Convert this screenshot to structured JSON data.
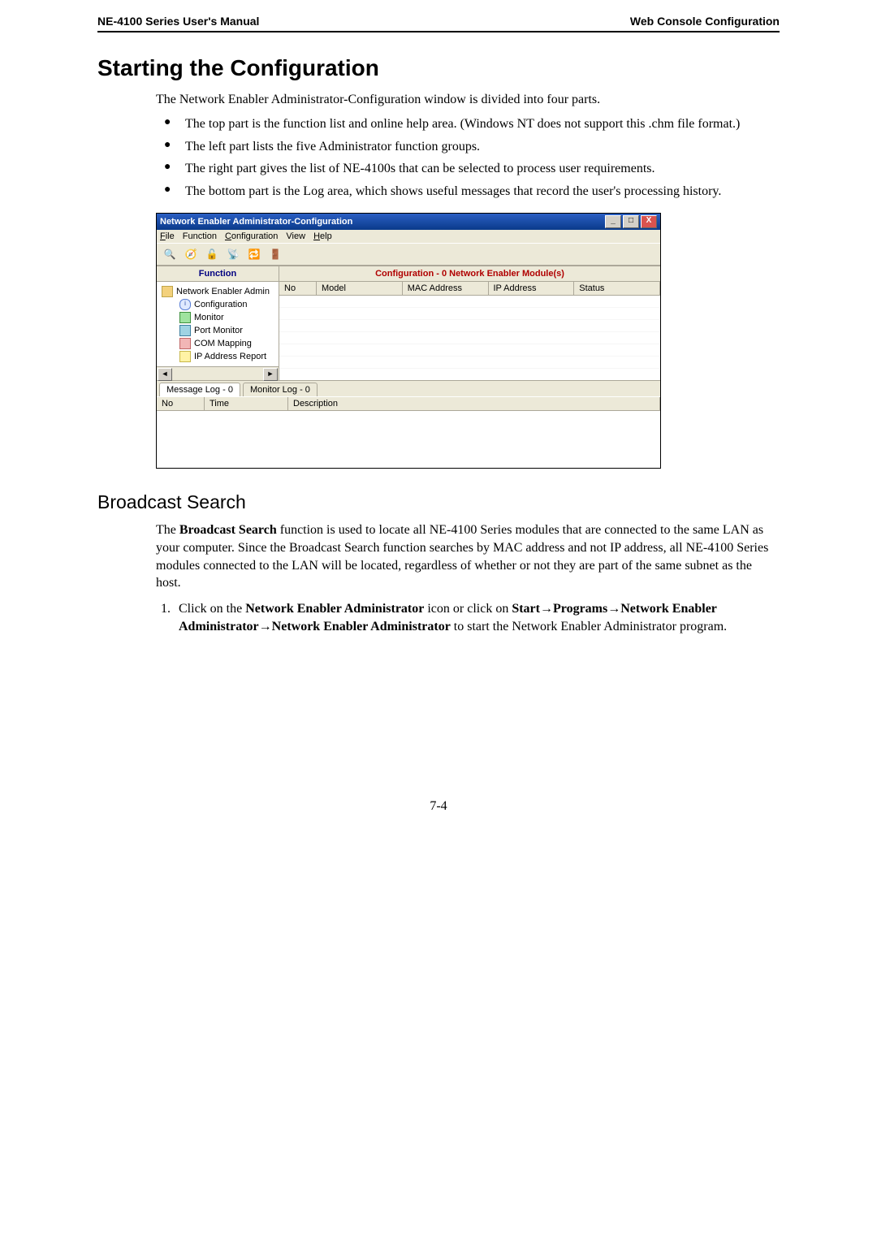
{
  "header": {
    "left": "NE-4100 Series User's Manual",
    "right": "Web Console Configuration"
  },
  "section_title": "Starting the Configuration",
  "intro": "The Network Enabler Administrator-Configuration window is divided into four parts.",
  "bullets": [
    "The top part is the function list and online help area. (Windows NT does not support this .chm file format.)",
    "The left part lists the five Administrator function groups.",
    "The right part gives the list of NE-4100s that can be selected to process user requirements.",
    "The bottom part is the Log area, which shows useful messages that record the user's processing history."
  ],
  "screenshot": {
    "title": "Network Enabler Administrator-Configuration",
    "win_buttons": {
      "min": "_",
      "max": "□",
      "close": "X"
    },
    "menu": [
      "File",
      "Function",
      "Configuration",
      "View",
      "Help"
    ],
    "menu_underlines": [
      "F",
      "",
      "C",
      "",
      "H"
    ],
    "toolbar_icons": [
      "search-icon",
      "locate-icon",
      "unlock-icon",
      "broadcast-icon",
      "refresh-icon",
      "exit-icon"
    ],
    "left_pane": {
      "header": "Function",
      "root": "Network Enabler Admin",
      "items": [
        "Configuration",
        "Monitor",
        "Port Monitor",
        "COM Mapping",
        "IP Address Report"
      ],
      "scroll_left": "◄",
      "scroll_right": "►"
    },
    "right_pane": {
      "header": "Configuration - 0 Network Enabler Module(s)",
      "columns": [
        "No",
        "Model",
        "MAC Address",
        "IP Address",
        "Status"
      ]
    },
    "tabs": [
      "Message Log - 0",
      "Monitor Log - 0"
    ],
    "log_columns": [
      "No",
      "Time",
      "Description"
    ]
  },
  "subsection_title": "Broadcast Search",
  "bs_para_parts": {
    "p1a": "The ",
    "p1b": "Broadcast Search",
    "p1c": " function is used to locate all NE-4100 Series modules that are connected to the same LAN as your computer. Since the Broadcast Search function searches by MAC address and not IP address, all NE-4100 Series modules connected to the LAN will be located, regardless of whether or not they are part of the same subnet as the host."
  },
  "step1": {
    "a": "Click on the ",
    "b": "Network Enabler Administrator",
    "c": " icon or click on ",
    "d": "Start",
    "arrow": "→",
    "e": "Programs",
    "f": "Network Enabler Administrator",
    "g": "Network Enabler Administrator",
    "h": " to start the Network Enabler Administrator program."
  },
  "page_number": "7-4"
}
